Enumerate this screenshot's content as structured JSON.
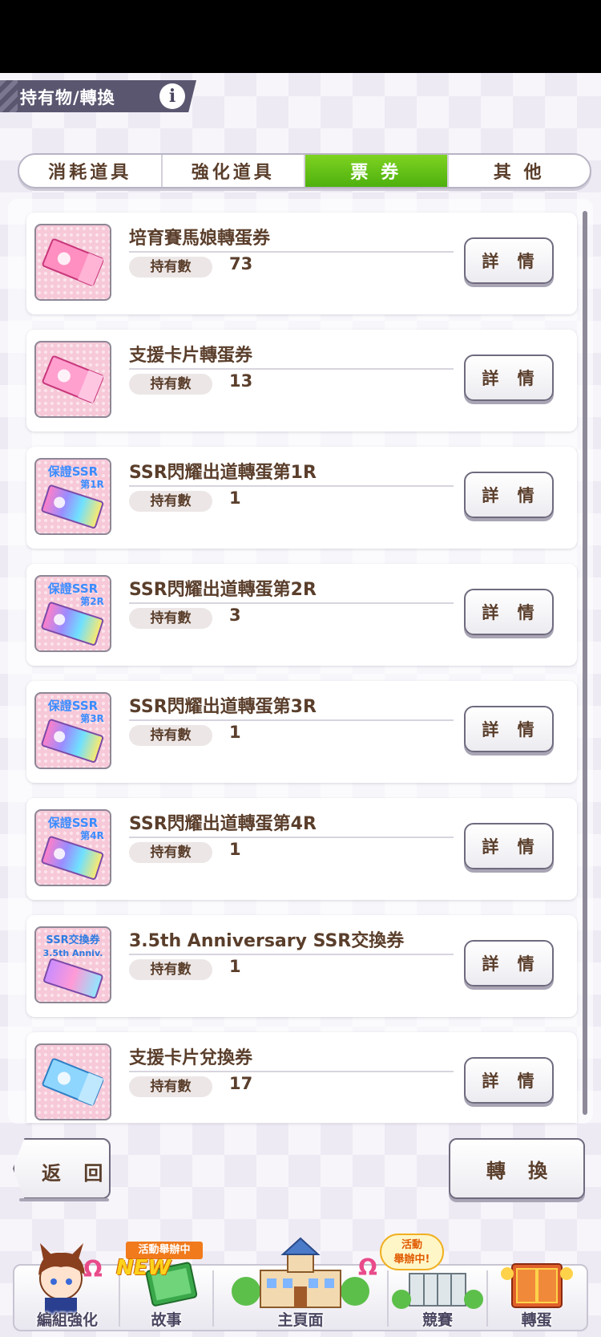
{
  "header": {
    "title": "持有物/轉換",
    "info_icon": "i"
  },
  "tabs": [
    {
      "label": "消耗道具",
      "active": false
    },
    {
      "label": "強化道具",
      "active": false
    },
    {
      "label": "票 券",
      "active": true
    },
    {
      "label": "其 他",
      "active": false
    }
  ],
  "items": [
    {
      "name": "培育賽馬娘轉蛋券",
      "qty_label": "持有數",
      "qty": "73",
      "detail_label": "詳 情",
      "icon": "pink-ticket-icon"
    },
    {
      "name": "支援卡片轉蛋券",
      "qty_label": "持有數",
      "qty": "13",
      "detail_label": "詳 情",
      "icon": "pink-ticket-icon"
    },
    {
      "name": "SSR閃耀出道轉蛋第1R",
      "qty_label": "持有數",
      "qty": "1",
      "detail_label": "詳 情",
      "icon": "rainbow-ticket-icon",
      "icon_line1": "保證SSR",
      "icon_line2": "第1R"
    },
    {
      "name": "SSR閃耀出道轉蛋第2R",
      "qty_label": "持有數",
      "qty": "3",
      "detail_label": "詳 情",
      "icon": "rainbow-ticket-icon",
      "icon_line1": "保證SSR",
      "icon_line2": "第2R"
    },
    {
      "name": "SSR閃耀出道轉蛋第3R",
      "qty_label": "持有數",
      "qty": "1",
      "detail_label": "詳 情",
      "icon": "rainbow-ticket-icon",
      "icon_line1": "保證SSR",
      "icon_line2": "第3R"
    },
    {
      "name": "SSR閃耀出道轉蛋第4R",
      "qty_label": "持有數",
      "qty": "1",
      "detail_label": "詳 情",
      "icon": "rainbow-ticket-icon",
      "icon_line1": "保證SSR",
      "icon_line2": "第4R"
    },
    {
      "name": "3.5th Anniversary SSR交換券",
      "qty_label": "持有數",
      "qty": "1",
      "detail_label": "詳 情",
      "icon": "anniversary-ticket-icon",
      "icon_line1": "SSR交換券",
      "icon_line2": "3.5th Anniv."
    },
    {
      "name": "支援卡片兌換券",
      "qty_label": "持有數",
      "qty": "17",
      "detail_label": "詳 情",
      "icon": "blue-ticket-icon"
    }
  ],
  "actions": {
    "back_label": "返 回",
    "convert_label": "轉 換"
  },
  "bottom_nav": {
    "items": [
      {
        "label": "編組強化"
      },
      {
        "label": "故事"
      },
      {
        "label": "主頁面"
      },
      {
        "label": "競賽"
      },
      {
        "label": "轉蛋"
      }
    ],
    "event_tag": "活動舉辦中",
    "new_tag": "NEW",
    "event_bubble_line1": "活動",
    "event_bubble_line2": "舉辦中!"
  },
  "colors": {
    "text_brown": "#5a3e2b",
    "active_tab_green": "#5ec214",
    "banner_purple": "#5b5670"
  }
}
